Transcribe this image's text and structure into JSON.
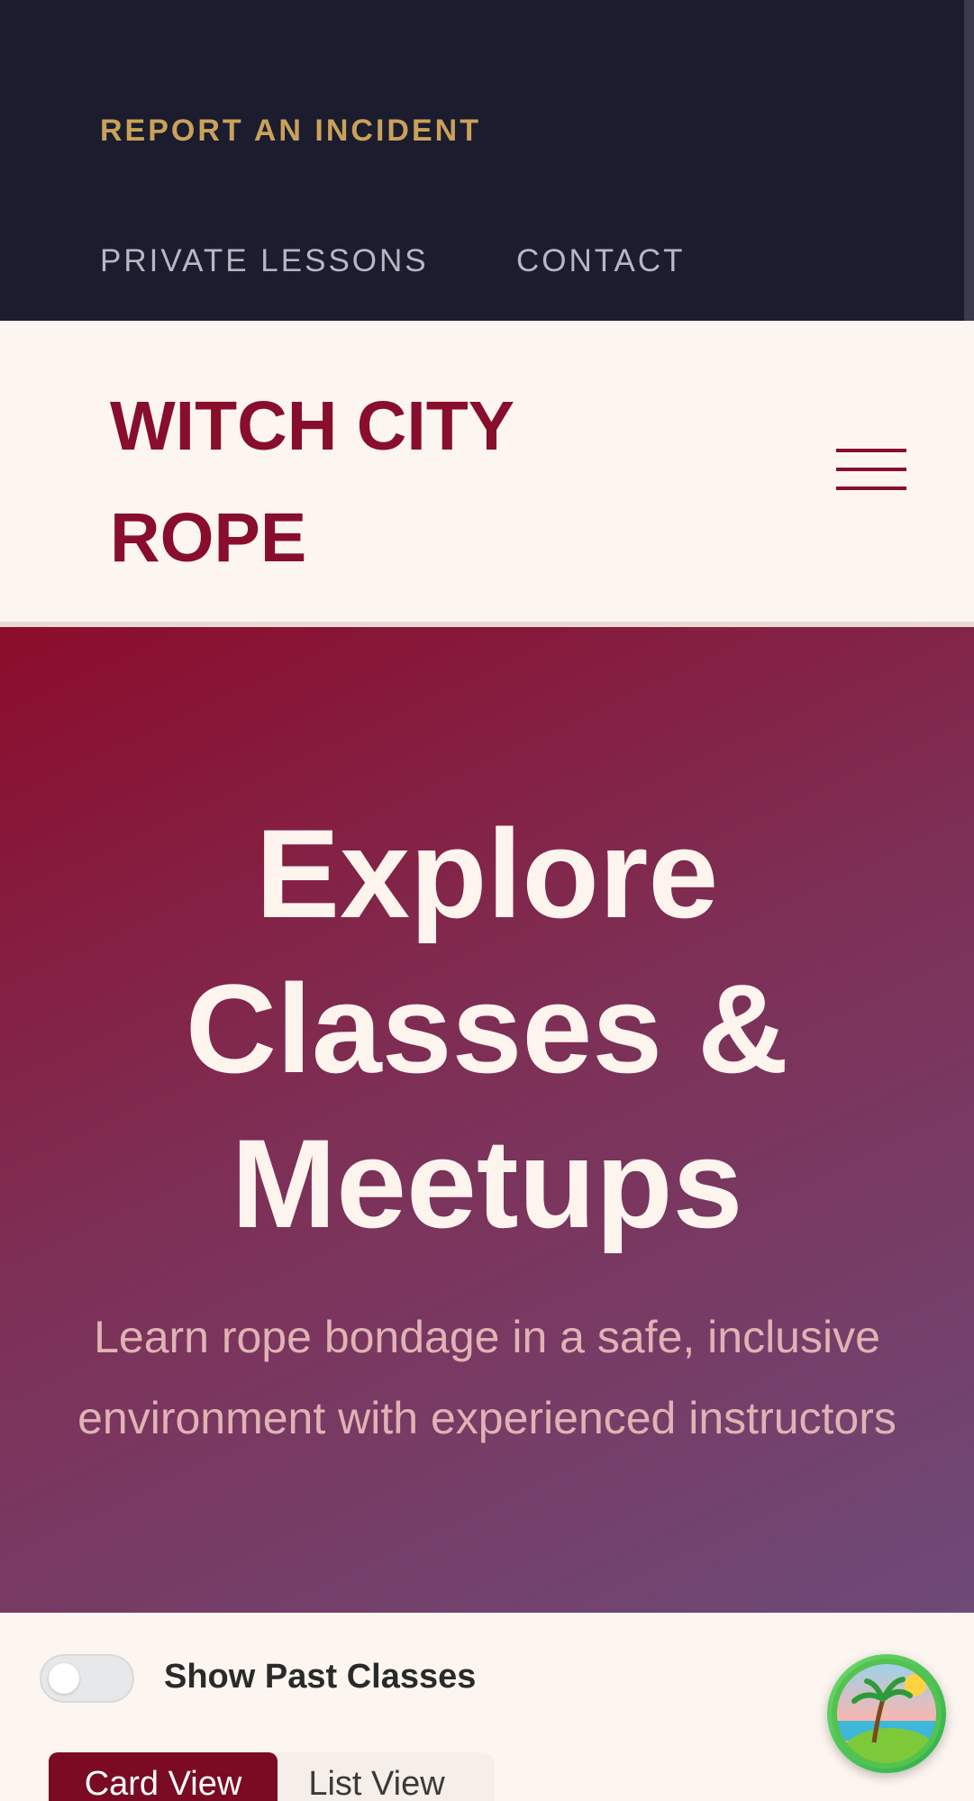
{
  "utility_nav": {
    "report_incident": "REPORT AN INCIDENT",
    "private_lessons": "PRIVATE LESSONS",
    "contact": "CONTACT"
  },
  "header": {
    "brand": "WITCH CITY ROPE",
    "menu_icon": "hamburger-menu-icon"
  },
  "hero": {
    "title": "Explore Classes & Meetups",
    "subtitle": "Learn rope bondage in a safe, inclusive environment with experienced instructors"
  },
  "filters": {
    "past_classes_toggle": {
      "label": "Show Past Classes",
      "checked": false
    },
    "view_options": [
      "Card View",
      "List View"
    ],
    "active_view": "Card View"
  },
  "floating_action": {
    "icon": "tropical-island-icon"
  },
  "colors": {
    "nav_background": "#1b1c2e",
    "accent_gold": "#c9a15a",
    "brand_burgundy": "#880e2c",
    "hero_gradient_start": "#8c0c2b",
    "hero_gradient_end": "#6e4a78",
    "page_background": "#fdf6f0"
  }
}
